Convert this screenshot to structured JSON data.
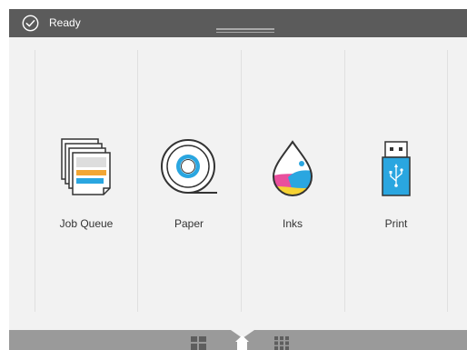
{
  "status": {
    "text": "Ready",
    "icon": "checkmark-circle-icon"
  },
  "tiles": [
    {
      "label": "Job Queue",
      "icon": "job-queue-icon"
    },
    {
      "label": "Paper",
      "icon": "paper-roll-icon"
    },
    {
      "label": "Inks",
      "icon": "ink-drop-icon"
    },
    {
      "label": "Print",
      "icon": "usb-drive-icon"
    }
  ],
  "bottom_nav": {
    "widgets_icon": "widgets-icon",
    "home_icon": "home-icon",
    "apps_icon": "apps-grid-icon"
  },
  "colors": {
    "status_bar": "#5b5b5b",
    "panel": "#f2f2f2",
    "bottom_bar": "#9a9a9a",
    "accent_blue": "#2aa6e0"
  }
}
